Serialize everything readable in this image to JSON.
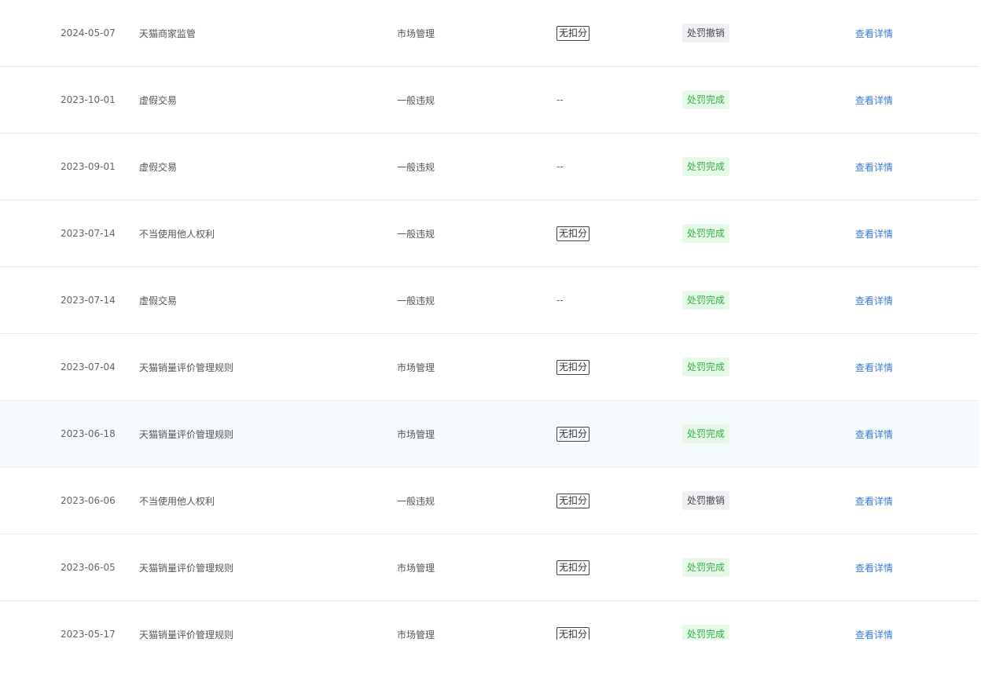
{
  "table": {
    "rows": [
      {
        "date": "2024-05-07",
        "name": "天猫商家监管",
        "type": "市场管理",
        "score": "无扣分",
        "status": "处罚撤销",
        "status_kind": "revoked",
        "action": "查看详情"
      },
      {
        "date": "2023-10-01",
        "name": "虚假交易",
        "type": "一般违规",
        "score": "--",
        "status": "处罚完成",
        "status_kind": "done",
        "action": "查看详情"
      },
      {
        "date": "2023-09-01",
        "name": "虚假交易",
        "type": "一般违规",
        "score": "--",
        "status": "处罚完成",
        "status_kind": "done",
        "action": "查看详情"
      },
      {
        "date": "2023-07-14",
        "name": "不当使用他人权利",
        "type": "一般违规",
        "score": "无扣分",
        "status": "处罚完成",
        "status_kind": "done",
        "action": "查看详情"
      },
      {
        "date": "2023-07-14",
        "name": "虚假交易",
        "type": "一般违规",
        "score": "--",
        "status": "处罚完成",
        "status_kind": "done",
        "action": "查看详情"
      },
      {
        "date": "2023-07-04",
        "name": "天猫销量评价管理规则",
        "type": "市场管理",
        "score": "无扣分",
        "status": "处罚完成",
        "status_kind": "done",
        "action": "查看详情"
      },
      {
        "date": "2023-06-18",
        "name": "天猫销量评价管理规则",
        "type": "市场管理",
        "score": "无扣分",
        "status": "处罚完成",
        "status_kind": "done",
        "action": "查看详情"
      },
      {
        "date": "2023-06-06",
        "name": "不当使用他人权利",
        "type": "一般违规",
        "score": "无扣分",
        "status": "处罚撤销",
        "status_kind": "revoked",
        "action": "查看详情"
      },
      {
        "date": "2023-06-05",
        "name": "天猫销量评价管理规则",
        "type": "市场管理",
        "score": "无扣分",
        "status": "处罚完成",
        "status_kind": "done",
        "action": "查看详情"
      },
      {
        "date": "2023-05-17",
        "name": "天猫销量评价管理规则",
        "type": "市场管理",
        "score": "无扣分",
        "status": "处罚完成",
        "status_kind": "done",
        "action": "查看详情"
      }
    ]
  },
  "colors": {
    "link": "#3a7bd5",
    "status_done_text": "#2fb344",
    "status_done_bg": "#e7f8e8",
    "status_revoked_bg": "#eef0f3",
    "row_highlight_bg": "#f5fafd",
    "divider": "#ebebeb"
  }
}
